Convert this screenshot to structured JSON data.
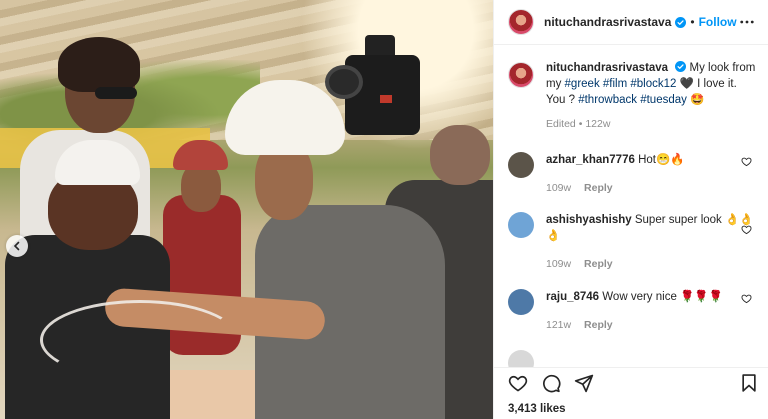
{
  "post": {
    "username": "nituchandrasrivastava",
    "follow_label": "Follow",
    "separator": "•",
    "caption": {
      "text_before": "My look from my ",
      "tags1": [
        "#greek",
        "#film",
        "#block12"
      ],
      "emoji1": "🖤",
      "text_mid": " I love it. You ? ",
      "tags2": [
        "#throwback",
        "#tuesday"
      ],
      "emoji2": "🤩",
      "edited": "Edited",
      "age": "122w"
    },
    "likes": "3,413 likes"
  },
  "comments": [
    {
      "username": "azhar_khan7776",
      "text": "Hot😁🔥",
      "age": "109w",
      "reply": "Reply",
      "avatar_color": "#5b5449"
    },
    {
      "username": "ashishyashishy",
      "text": "Super super look 👌👌👌",
      "age": "109w",
      "reply": "Reply",
      "avatar_color": "#6fa4d6"
    },
    {
      "username": "raju_8746",
      "text": "Wow very nice 🌹🌹🌹",
      "age": "121w",
      "reply": "Reply",
      "avatar_color": "#4e79a7"
    }
  ],
  "colors": {
    "accent": "#0095f6",
    "hashtag": "#00376b",
    "muted": "#8e8e8e",
    "verified": "#0095f6"
  },
  "icons": {
    "verified": "verified-badge-icon",
    "more": "more-horizontal-icon",
    "like": "heart-icon",
    "comment": "comment-bubble-icon",
    "share": "paper-plane-icon",
    "save": "bookmark-icon",
    "prev": "chevron-left-icon"
  }
}
